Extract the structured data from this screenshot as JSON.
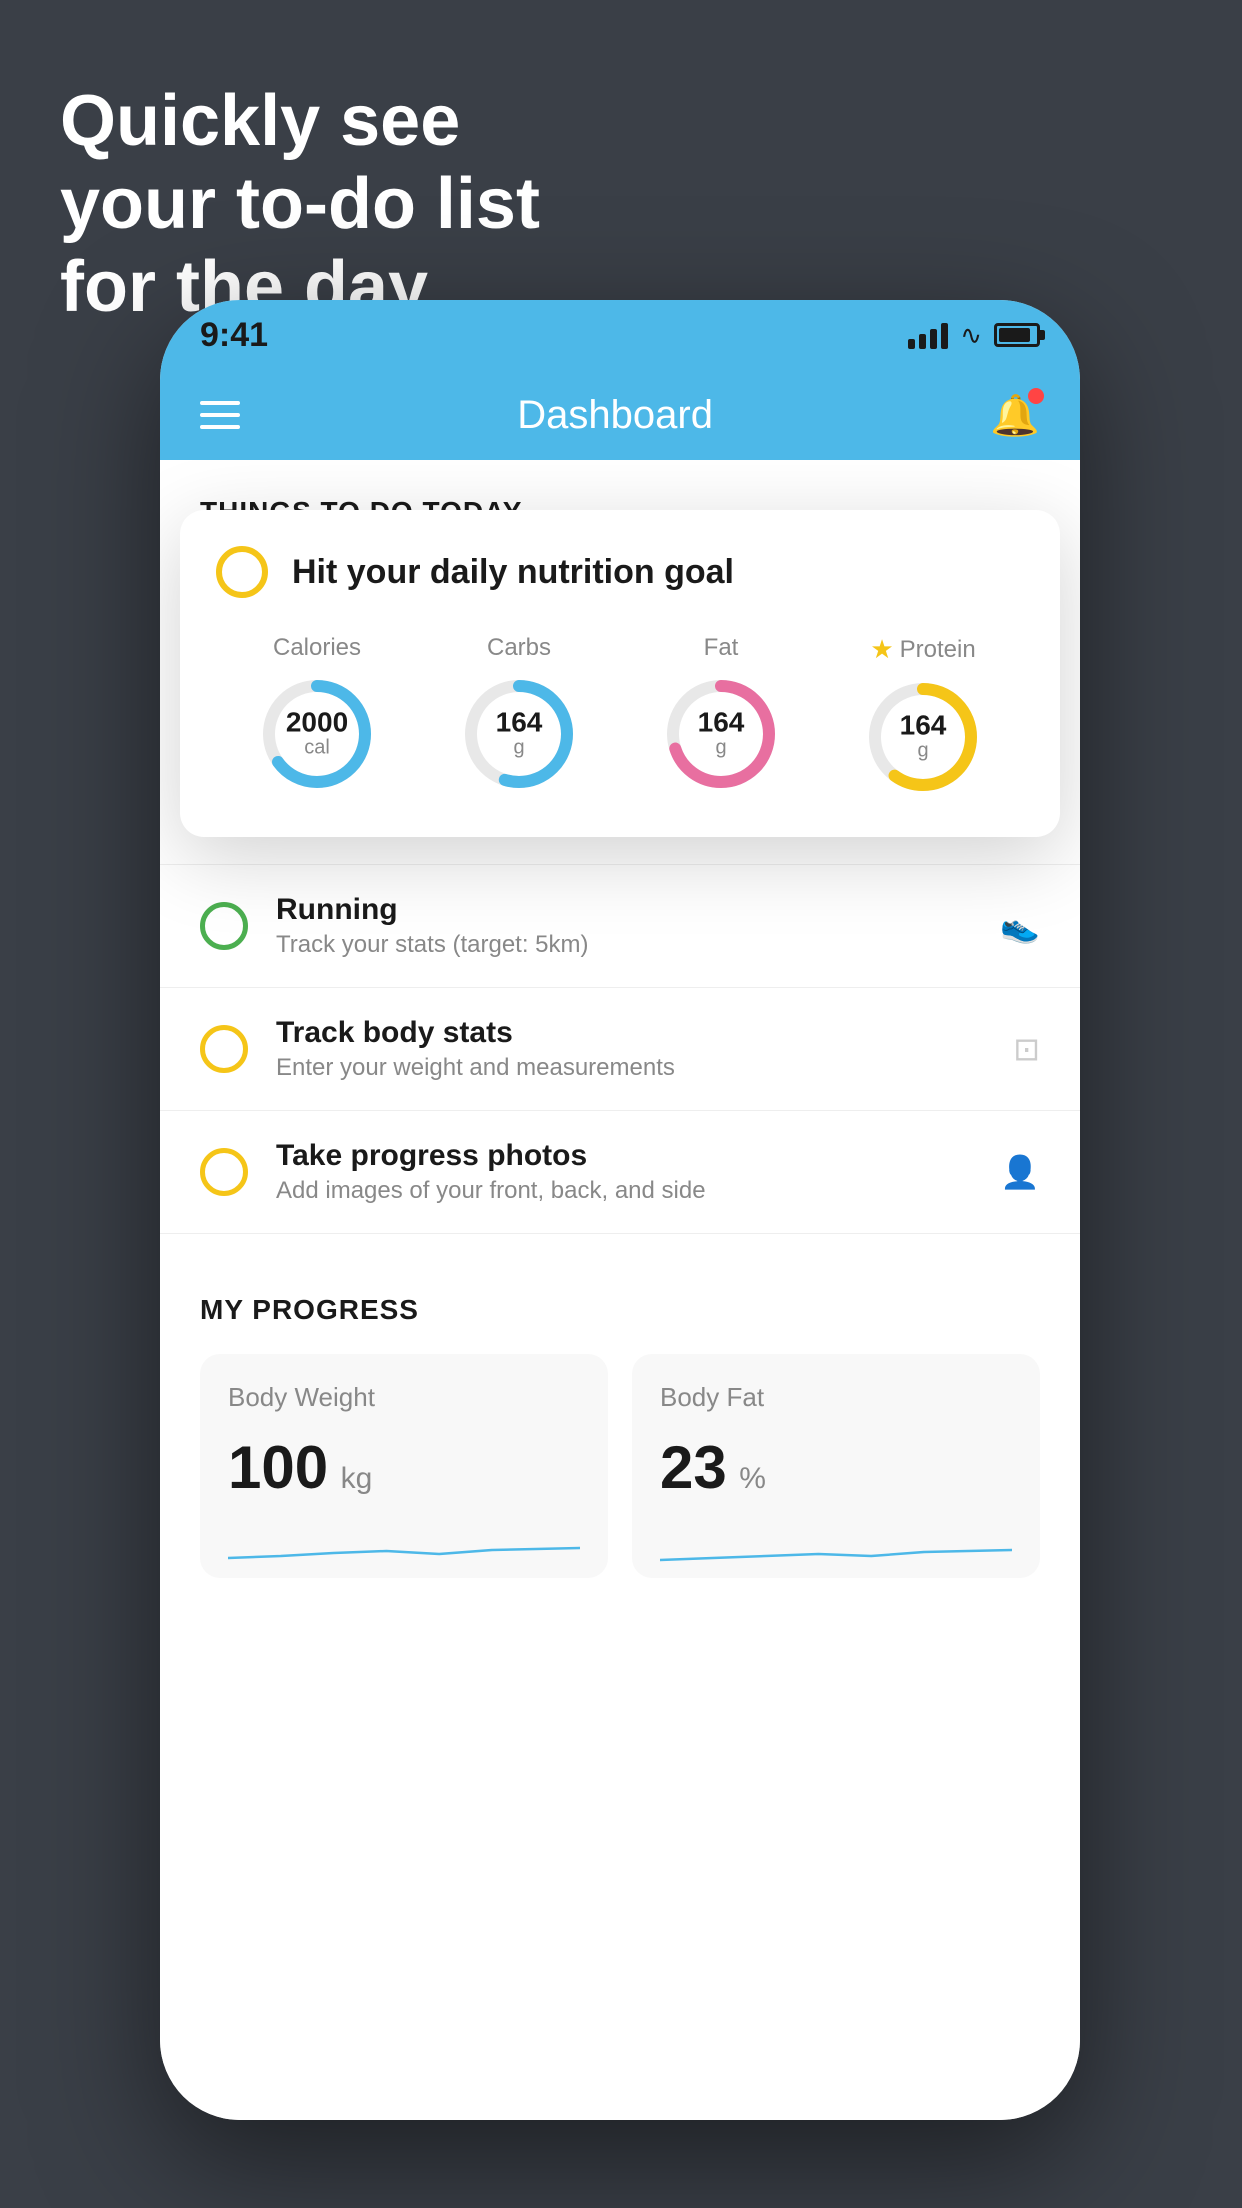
{
  "headline": {
    "line1": "Quickly see",
    "line2": "your to-do list",
    "line3": "for the day."
  },
  "status_bar": {
    "time": "9:41"
  },
  "app_header": {
    "title": "Dashboard"
  },
  "things_section": {
    "label": "THINGS TO DO TODAY"
  },
  "nutrition_card": {
    "title": "Hit your daily nutrition goal",
    "macros": [
      {
        "label": "Calories",
        "value": "2000",
        "unit": "cal",
        "color": "#4db8e8",
        "percent": 65,
        "starred": false
      },
      {
        "label": "Carbs",
        "value": "164",
        "unit": "g",
        "color": "#4db8e8",
        "percent": 55,
        "starred": false
      },
      {
        "label": "Fat",
        "value": "164",
        "unit": "g",
        "color": "#e86fa0",
        "percent": 70,
        "starred": false
      },
      {
        "label": "Protein",
        "value": "164",
        "unit": "g",
        "color": "#f5c518",
        "percent": 60,
        "starred": true
      }
    ]
  },
  "todo_items": [
    {
      "title": "Running",
      "subtitle": "Track your stats (target: 5km)",
      "circle_color": "green",
      "icon": "👟"
    },
    {
      "title": "Track body stats",
      "subtitle": "Enter your weight and measurements",
      "circle_color": "yellow",
      "icon": "⚖"
    },
    {
      "title": "Take progress photos",
      "subtitle": "Add images of your front, back, and side",
      "circle_color": "yellow",
      "icon": "👤"
    }
  ],
  "progress_section": {
    "label": "MY PROGRESS",
    "cards": [
      {
        "label": "Body Weight",
        "value": "100",
        "unit": "kg"
      },
      {
        "label": "Body Fat",
        "value": "23",
        "unit": "%"
      }
    ]
  }
}
